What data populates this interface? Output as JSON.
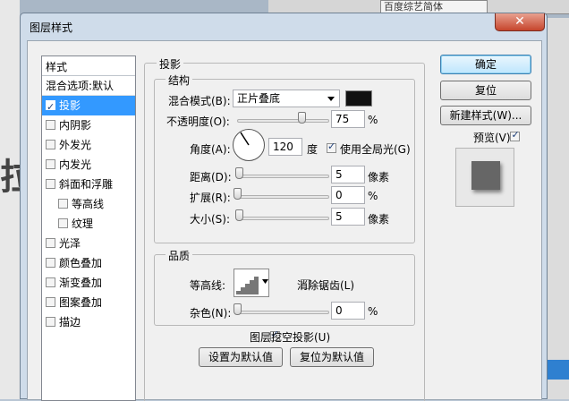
{
  "background": {
    "font_name": "百度综艺简体",
    "big_char": "拉"
  },
  "dialog": {
    "title": "图层样式",
    "close_glyph": "✕"
  },
  "style_list": {
    "header": "样式",
    "blend_row": "混合选项:默认",
    "items": [
      {
        "label": "投影",
        "checked": true,
        "selected": true,
        "indent": false
      },
      {
        "label": "内阴影",
        "checked": false,
        "selected": false,
        "indent": false
      },
      {
        "label": "外发光",
        "checked": false,
        "selected": false,
        "indent": false
      },
      {
        "label": "内发光",
        "checked": false,
        "selected": false,
        "indent": false
      },
      {
        "label": "斜面和浮雕",
        "checked": false,
        "selected": false,
        "indent": false
      },
      {
        "label": "等高线",
        "checked": false,
        "selected": false,
        "indent": true
      },
      {
        "label": "纹理",
        "checked": false,
        "selected": false,
        "indent": true
      },
      {
        "label": "光泽",
        "checked": false,
        "selected": false,
        "indent": false
      },
      {
        "label": "颜色叠加",
        "checked": false,
        "selected": false,
        "indent": false
      },
      {
        "label": "渐变叠加",
        "checked": false,
        "selected": false,
        "indent": false
      },
      {
        "label": "图案叠加",
        "checked": false,
        "selected": false,
        "indent": false
      },
      {
        "label": "描边",
        "checked": false,
        "selected": false,
        "indent": false
      }
    ]
  },
  "shadow": {
    "section_title": "投影",
    "structure_title": "结构",
    "blend_mode_label": "混合模式(B):",
    "blend_mode_value": "正片叠底",
    "blend_color": "#111111",
    "opacity_label": "不透明度(O):",
    "opacity_value": "75",
    "opacity_unit": "%",
    "angle_label": "角度(A):",
    "angle_value": "120",
    "angle_unit": "度",
    "global_light_label": "使用全局光(G)",
    "distance_label": "距离(D):",
    "distance_value": "5",
    "distance_unit": "像素",
    "spread_label": "扩展(R):",
    "spread_value": "0",
    "spread_unit": "%",
    "size_label": "大小(S):",
    "size_value": "5",
    "size_unit": "像素",
    "quality_title": "品质",
    "contour_label": "等高线:",
    "antialias_label": "消除锯齿(L)",
    "noise_label": "杂色(N):",
    "noise_value": "0",
    "noise_unit": "%",
    "knockout_label": "图层挖空投影(U)",
    "set_default_label": "设置为默认值",
    "reset_default_label": "复位为默认值"
  },
  "buttons": {
    "ok": "确定",
    "reset": "复位",
    "new_style": "新建样式(W)...",
    "preview_label": "预览(V)"
  }
}
